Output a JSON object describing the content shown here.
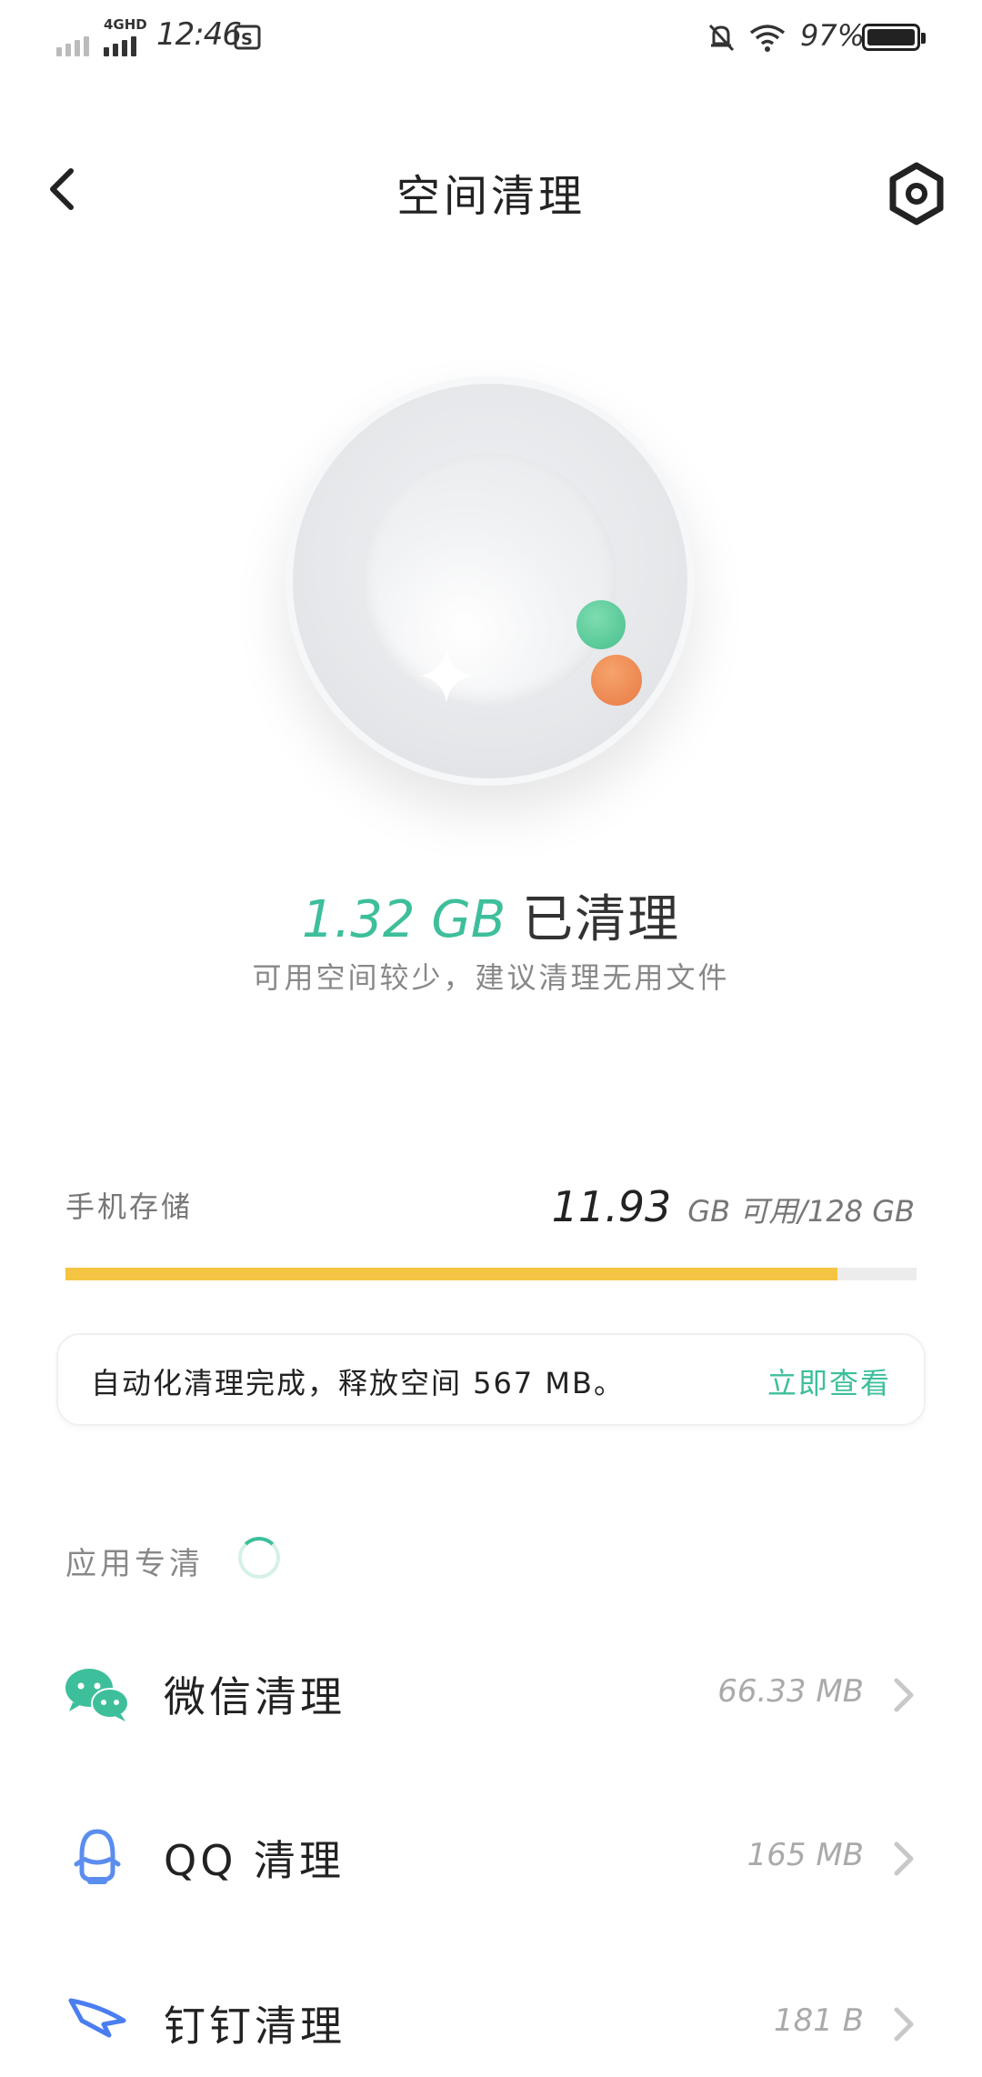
{
  "status_bar": {
    "network": "4GHD",
    "time": "12:46",
    "battery_percent": "97%",
    "battery_level": 0.97
  },
  "header": {
    "title": "空间清理"
  },
  "result": {
    "amount": "1.32 GB",
    "label": "已清理",
    "subtitle": "可用空间较少，建议清理无用文件"
  },
  "storage": {
    "label": "手机存储",
    "available_value": "11.93",
    "available_suffix": "GB 可用/128 GB",
    "used_fraction": 0.907,
    "bar_color": "#f4c443"
  },
  "notice": {
    "message": "自动化清理完成，释放空间 567 MB。",
    "action": "立即查看"
  },
  "apps_section": {
    "label": "应用专清",
    "items": [
      {
        "name": "微信清理",
        "size": "66.33 MB",
        "icon": "wechat-icon",
        "color": "#3dbf9b"
      },
      {
        "name": "QQ 清理",
        "size": "165 MB",
        "icon": "qq-icon",
        "color": "#5b8def"
      },
      {
        "name": "钉钉清理",
        "size": "181 B",
        "icon": "dingtalk-icon",
        "color": "#4a7ef0"
      }
    ]
  },
  "colors": {
    "accent": "#3dbf9b",
    "orange": "#e97a45"
  }
}
